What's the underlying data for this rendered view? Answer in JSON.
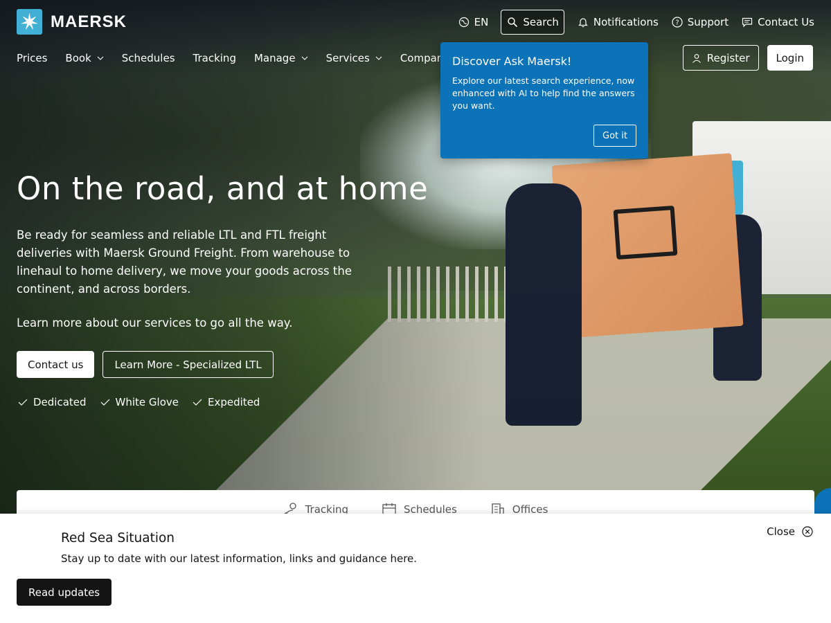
{
  "brand": {
    "name": "MAERSK",
    "accent": "#42b0d5",
    "popover_bg": "#0c73b8"
  },
  "utility": {
    "language": "EN",
    "search": "Search",
    "notifications": "Notifications",
    "support": "Support",
    "contact": "Contact Us"
  },
  "nav": {
    "items": [
      {
        "label": "Prices",
        "dropdown": false
      },
      {
        "label": "Book",
        "dropdown": true
      },
      {
        "label": "Schedules",
        "dropdown": false
      },
      {
        "label": "Tracking",
        "dropdown": false
      },
      {
        "label": "Manage",
        "dropdown": true
      },
      {
        "label": "Services",
        "dropdown": true
      },
      {
        "label": "Company",
        "dropdown": false
      }
    ],
    "register": "Register",
    "login": "Login"
  },
  "popover": {
    "title": "Discover Ask Maersk!",
    "body": "Explore our latest search experience, now enhanced with AI to help find the answers you want.",
    "button": "Got it"
  },
  "hero": {
    "title": "On the road, and at home",
    "description": "Be ready for seamless and reliable LTL and FTL freight deliveries with Maersk Ground Freight. From warehouse to linehaul to home delivery, we move your goods across the continent, and across borders.",
    "learn": "Learn more about our services to go all the way.",
    "cta_primary": "Contact us",
    "cta_secondary": "Learn More - Specialized LTL",
    "features": [
      "Dedicated",
      "White Glove",
      "Expedited"
    ]
  },
  "quick_tabs": [
    "Tracking",
    "Schedules",
    "Offices"
  ],
  "banner": {
    "title": "Red Sea Situation",
    "text": "Stay up to date with our latest information, links and guidance here.",
    "close": "Close",
    "button": "Read updates"
  }
}
